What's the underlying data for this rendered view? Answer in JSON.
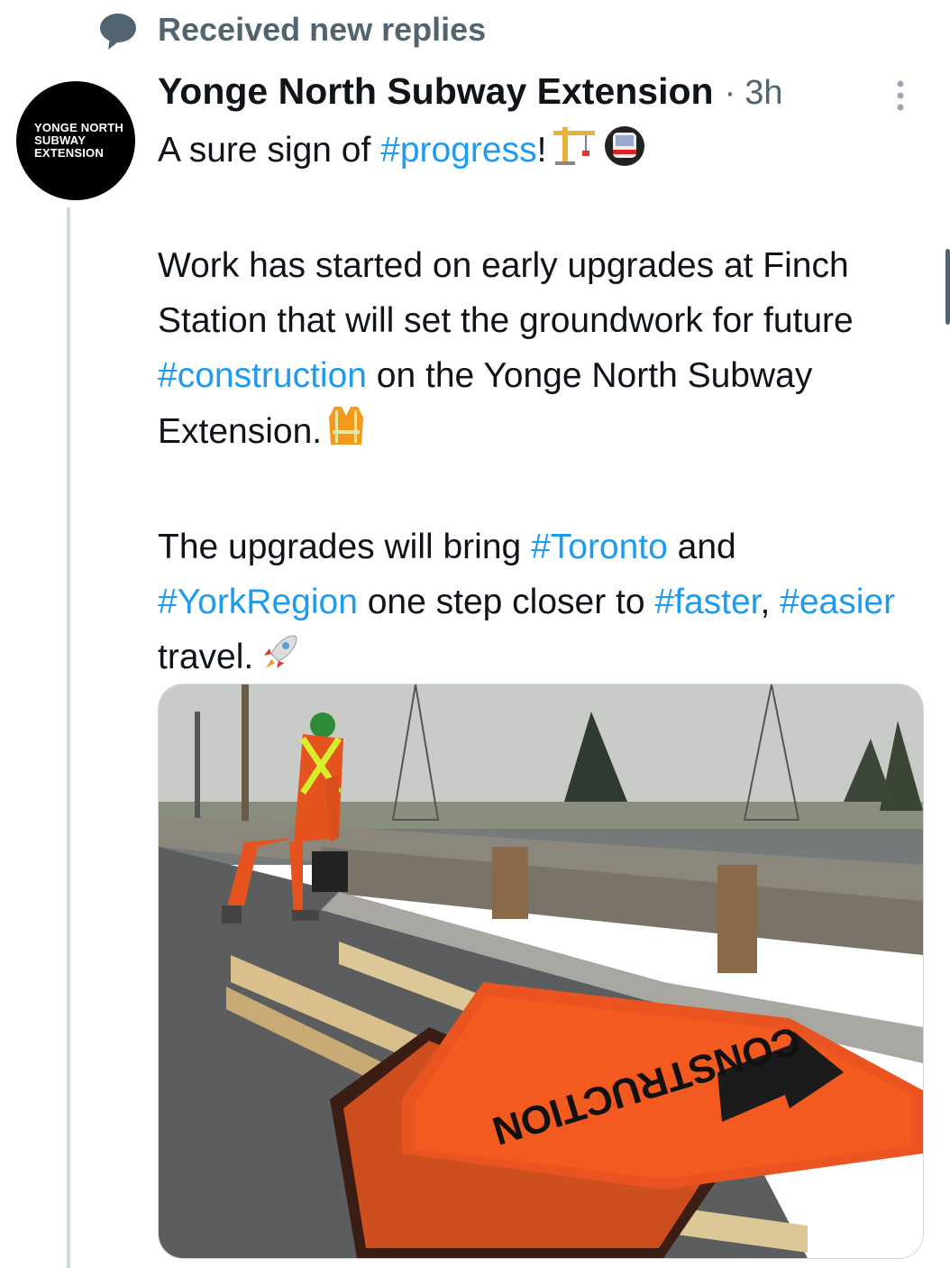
{
  "notification": {
    "icon": "speech-bubble-icon",
    "text": "Received new replies"
  },
  "tweet": {
    "avatar": {
      "lines": [
        "YONGE NORTH",
        "SUBWAY",
        "EXTENSION"
      ]
    },
    "author": "Yonge North Subway Extension",
    "separator": "·",
    "time": "3h",
    "more_icon": "vertical-ellipsis-icon",
    "line1_text": "A sure sign of ",
    "line1_hashtag": "#progress",
    "line1_end": "!",
    "emoji1": "construction-crane-emoji",
    "emoji2": "metro-train-emoji",
    "p2_a": "Work has started on early upgrades at Finch Station that will set the groundwork for future ",
    "p2_hashtag": "#construction",
    "p2_b": " on the Yonge North Subway Extension.",
    "emoji3": "safety-vest-emoji",
    "p3_a": "The upgrades will bring ",
    "p3_h1": "#Toronto",
    "p3_b": " and ",
    "p3_h2": "#YorkRegion",
    "p3_c": " one step closer to ",
    "p3_h3": "#faster",
    "p3_d": ", ",
    "p3_h4": "#easier",
    "p3_e": " travel.",
    "emoji4": "rocket-emoji",
    "media": {
      "sign_text": "CONSTRUCTION"
    }
  },
  "colors": {
    "hashtag": "#1d9bf0",
    "muted": "#536471",
    "text": "#0f1419",
    "thread_line": "#cfd9de",
    "sign_orange": "#f25a20"
  }
}
